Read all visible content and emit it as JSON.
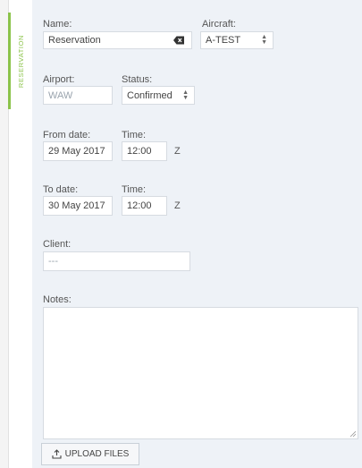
{
  "tab": {
    "label": "RESERVATION"
  },
  "form": {
    "name": {
      "label": "Name:",
      "value": "Reservation"
    },
    "aircraft": {
      "label": "Aircraft:",
      "value": "A-TEST"
    },
    "airport": {
      "label": "Airport:",
      "value": "WAW"
    },
    "status": {
      "label": "Status:",
      "value": "Confirmed"
    },
    "from_date": {
      "label": "From date:",
      "value": "29 May 2017"
    },
    "from_time": {
      "label": "Time:",
      "value": "12:00",
      "zone": "Z"
    },
    "to_date": {
      "label": "To date:",
      "value": "30 May 2017"
    },
    "to_time": {
      "label": "Time:",
      "value": "12:00",
      "zone": "Z"
    },
    "client": {
      "label": "Client:",
      "value": "---"
    },
    "notes": {
      "label": "Notes:",
      "value": ""
    }
  },
  "upload": {
    "label": "UPLOAD FILES"
  },
  "colors": {
    "accent": "#8bc34a",
    "panel_bg": "#eef2f7",
    "border": "#d6dbe1"
  },
  "icons": {
    "clear": "backspace-icon",
    "select": "select-arrows-icon",
    "upload": "upload-icon",
    "resize": "resize-grip-icon"
  }
}
